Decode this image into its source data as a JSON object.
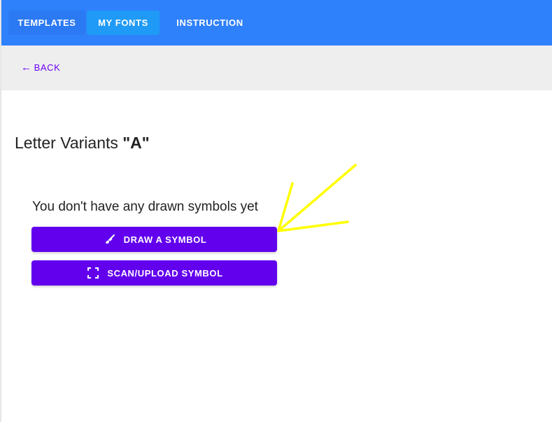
{
  "nav": {
    "tabs": [
      {
        "label": "TEMPLATES"
      },
      {
        "label": "MY FONTS",
        "active": true
      },
      {
        "label": "INSTRUCTION"
      }
    ],
    "accent": "#2f80fb"
  },
  "subnav": {
    "back_label": "BACK",
    "back_icon": "arrow-left-icon"
  },
  "main": {
    "title_prefix": "Letter Variants ",
    "title_letter": "\"A\"",
    "empty_message": "You don't have any drawn symbols yet",
    "buttons": [
      {
        "label": "DRAW A SYMBOL",
        "icon": "brush-icon"
      },
      {
        "label": "SCAN/UPLOAD SYMBOL",
        "icon": "scan-frame-icon"
      }
    ],
    "button_color": "#6200ee"
  },
  "annotation": {
    "arrow_color": "#ffff00"
  }
}
